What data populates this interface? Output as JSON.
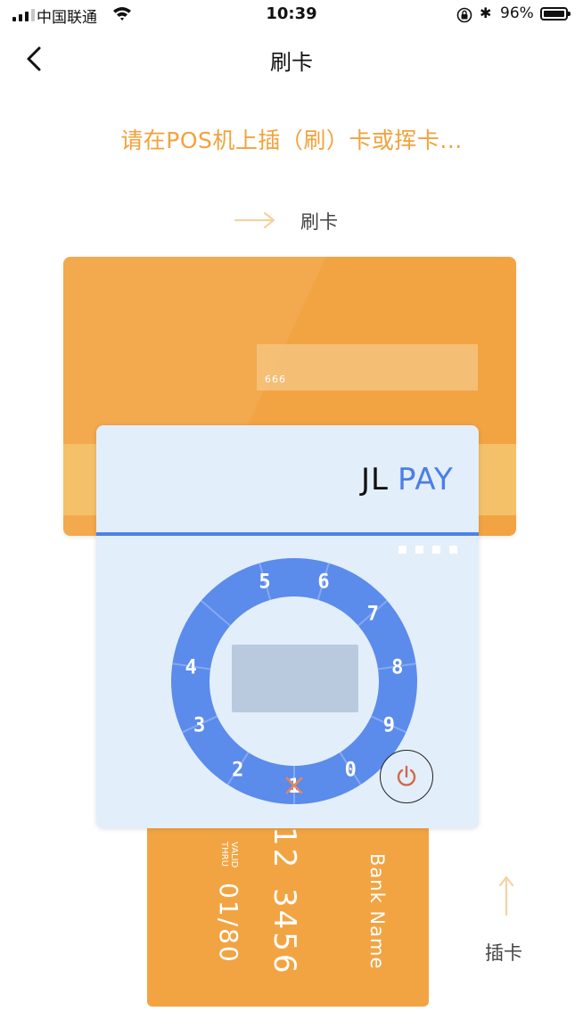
{
  "status_bar": {
    "carrier": "中国联通",
    "time": "10:39",
    "battery_percent": "96%",
    "battery_level": 0.96,
    "icons": [
      "signal-icon",
      "wifi-icon",
      "orientation-lock-icon",
      "bluetooth-icon",
      "battery-icon"
    ]
  },
  "nav": {
    "title": "刷卡",
    "back_icon": "chevron-left-icon"
  },
  "prompt": "请在POS机上插（刷）卡或挥卡...",
  "swipe": {
    "label": "刷卡",
    "icon": "arrow-right-icon"
  },
  "insert": {
    "label": "插卡",
    "icon": "arrow-up-icon"
  },
  "card_back": {
    "cvv": "666"
  },
  "card_front": {
    "bank_name": "Bank Name",
    "number_line1": "12",
    "number_line2": "3456",
    "valid_label_1": "VALID",
    "valid_label_2": "THRU",
    "expiry": "01/80"
  },
  "device": {
    "logo_jl": "JL",
    "logo_pay": "PAY",
    "keys": [
      "5",
      "6",
      "7",
      "8",
      "9",
      "0",
      "1",
      "2",
      "3",
      "4"
    ],
    "cancel_icon": "close-icon",
    "power_icon": "power-icon"
  },
  "colors": {
    "accent_orange": "#f2a23b",
    "card_orange": "#f2a443",
    "device_blue": "#4c82e8",
    "device_bg": "#e3eefb"
  }
}
